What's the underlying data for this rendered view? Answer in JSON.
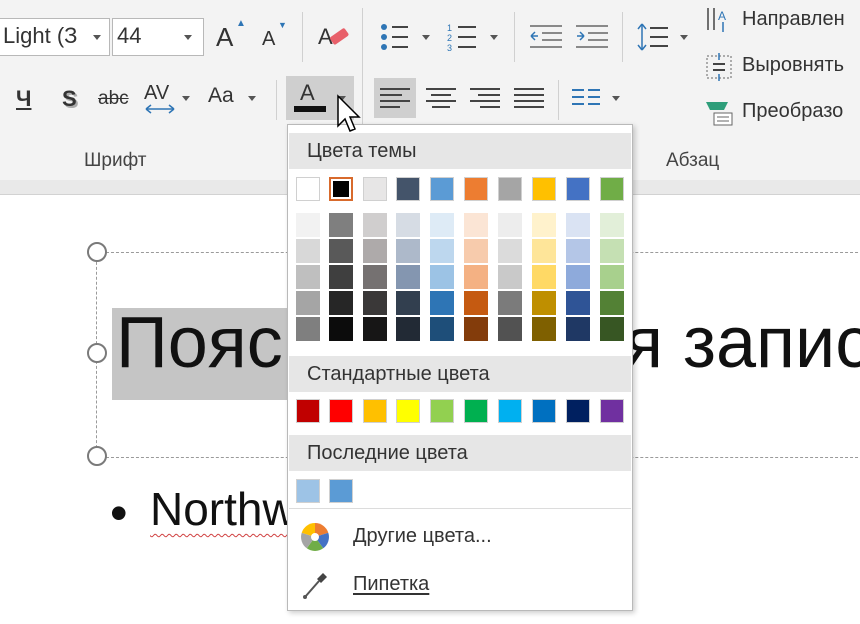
{
  "ribbon": {
    "font_name": "Light (З",
    "font_size": "44",
    "group_font_label": "Шрифт",
    "group_para_label": "Абзац",
    "underline_label": "Ч",
    "shadow_label": "S",
    "strike_label": "abc",
    "spacing_label": "AV",
    "case_label": "Aa",
    "color_label": "A",
    "text_direction_label": "Направлен",
    "align_text_label": "Выровнять",
    "convert_label": "Преобразо"
  },
  "slide": {
    "title": "Поясн               я запис",
    "title_left": "Пояс",
    "title_right": "я запис",
    "bullet_text": "Northw"
  },
  "dropdown": {
    "theme_header": "Цвета темы",
    "standard_header": "Стандартные цвета",
    "recent_header": "Последние цвета",
    "more_colors": "Другие цвета...",
    "eyedropper": "Пипетка",
    "theme_colors": [
      "#ffffff",
      "#000000",
      "#e7e6e6",
      "#44546a",
      "#5b9bd5",
      "#ed7d31",
      "#a5a5a5",
      "#ffc000",
      "#4472c4",
      "#70ad47"
    ],
    "theme_shades": [
      [
        "#f2f2f2",
        "#d8d8d8",
        "#bfbfbf",
        "#a5a5a5",
        "#7f7f7f"
      ],
      [
        "#7f7f7f",
        "#595959",
        "#3f3f3f",
        "#262626",
        "#0c0c0c"
      ],
      [
        "#d0cece",
        "#aeaaaa",
        "#757171",
        "#3a3838",
        "#171616"
      ],
      [
        "#d6dce4",
        "#adb9ca",
        "#8496b0",
        "#323f4f",
        "#222a35"
      ],
      [
        "#deebf6",
        "#bdd7ee",
        "#9cc3e5",
        "#2e75b5",
        "#1e4e79"
      ],
      [
        "#fbe5d5",
        "#f7cbac",
        "#f4b183",
        "#c55a11",
        "#833c0b"
      ],
      [
        "#ededed",
        "#dbdbdb",
        "#c9c9c9",
        "#7b7b7b",
        "#525252"
      ],
      [
        "#fff2cc",
        "#fee599",
        "#ffd965",
        "#bf8f00",
        "#7f6000"
      ],
      [
        "#dae3f3",
        "#b4c6e7",
        "#8eaadb",
        "#2f5496",
        "#1f3864"
      ],
      [
        "#e2efd9",
        "#c5e0b3",
        "#a8d08d",
        "#538135",
        "#375623"
      ]
    ],
    "standard_colors": [
      "#c00000",
      "#ff0000",
      "#ffc000",
      "#ffff00",
      "#92d050",
      "#00b050",
      "#00b0f0",
      "#0070c0",
      "#002060",
      "#7030a0"
    ],
    "recent_colors": [
      "#9dc3e6",
      "#5b9bd5"
    ],
    "selected_theme_index": 1
  },
  "colors": {
    "ribbon_bg": "#f3f3f3",
    "font_color_bar": "#111111",
    "selection": "#c5c5c5"
  }
}
